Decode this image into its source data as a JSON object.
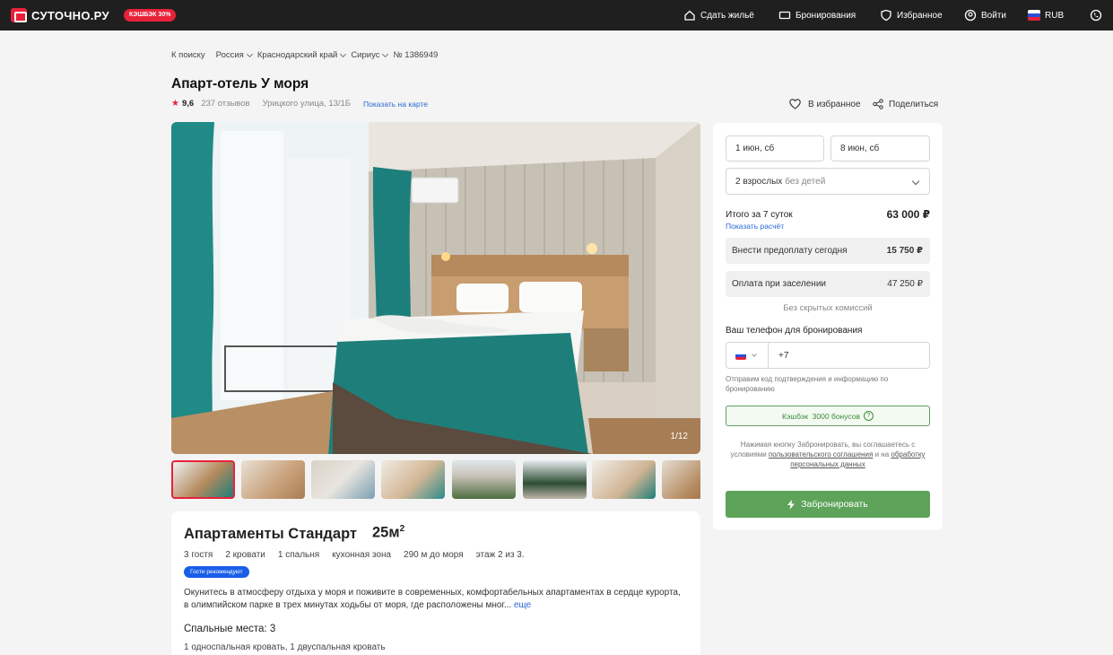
{
  "header": {
    "logo_text": "СУТОЧНО.РУ",
    "cashback_badge": "КЭШБЭК 30%",
    "nav": {
      "rent_out": "Сдать жильё",
      "bookings": "Бронирования",
      "favorites": "Избранное",
      "login": "Войти",
      "currency": "RUB"
    }
  },
  "breadcrumbs": {
    "back": "К поиску",
    "country": "Россия",
    "region": "Краснодарский край",
    "city": "Сириус",
    "listing_no": "№ 1386949"
  },
  "listing": {
    "title": "Апарт-отель У моря",
    "rating": "9,6",
    "reviews": "237 отзывов",
    "address": "Урицкого улица, 13/1Б",
    "map_link": "Показать на карте",
    "favorite_label": "В избранное",
    "share_label": "Поделиться",
    "photo_counter": "1/12",
    "thumbnail_count": 8
  },
  "apartment": {
    "name": "Апартаменты Стандарт",
    "area": "25м",
    "area_sup": "2",
    "features": [
      "3 гостя",
      "2 кровати",
      "1 спальня",
      "кухонная зона",
      "290 м до моря",
      "этаж 2 из 3."
    ],
    "badge": "Гости рекомендуют",
    "description": "Окунитесь в атмосферу отдыха у моря и поживите в современных, комфортабельных апартаментах в сердце курорта, в олимпийском парке в трех минутах ходьбы от моря, где расположены мног...",
    "more_link": "еще",
    "beds_heading": "Спальные места: 3",
    "beds_detail": "1 односпальная кровать, 1 двуспальная кровать"
  },
  "booking": {
    "checkin": "1 июн, сб",
    "checkout": "8 июн, сб",
    "guests": "2 взрослых",
    "guests_suffix": "без детей",
    "total_label": "Итого за 7 суток",
    "total_value": "63 000 ₽",
    "calc_link": "Показать расчёт",
    "prepay_label": "Внести предоплату сегодня",
    "prepay_value": "15 750 ₽",
    "checkin_pay_label": "Оплата при заселении",
    "checkin_pay_value": "47 250 ₽",
    "no_fees": "Без скрытых комиссий",
    "phone_label": "Ваш телефон для бронирования",
    "phone_value": "+7",
    "phone_hint": "Отправим код подтверждения и информацию по бронированию",
    "cashback_text": "Кэшбэк  3000 бонусов",
    "agree_prefix": "Нажимая кнопку Забронировать, вы соглашаетесь с условиями",
    "agree_link1": "пользовательского соглашения",
    "agree_mid": "и на",
    "agree_link2": "обработку персональных данных",
    "book_button": "Забронировать"
  },
  "colors": {
    "brand_red": "#e8213a",
    "book_green": "#5ea35a",
    "link_blue": "#2a6ad8"
  }
}
